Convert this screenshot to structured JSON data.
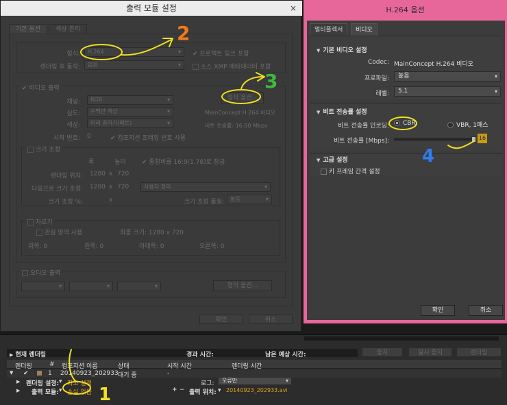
{
  "left_dialog": {
    "title": "출력 모듈 설정",
    "close_glyph": "×",
    "tabs": [
      "기본 옵션",
      "색상 관리"
    ],
    "format_label": "형식:",
    "format_value": "H.264",
    "post_render_label": "렌더링 후 동작:",
    "post_render_value": "없음",
    "include_project_link": "프로젝트 링크 포함",
    "include_xmp": "소스 XMP 메타데이터 포함",
    "video_output": "비디오 출력",
    "channels_label": "채널:",
    "channels_value": "RGB",
    "depth_label": "심도:",
    "depth_value": "수백만 색상",
    "color_label": "색상:",
    "color_value": "미리 곱하기(매트)",
    "start_label": "시작 번호:",
    "start_value": "0",
    "use_comp_frame": "컴포지션 프레임 번호 사용",
    "format_options_button": "형식 옵션...",
    "codec_info_1": "MainConcept H.264 비디오",
    "codec_info_2": "비트 전송률: 16.00 Mbps",
    "resize_label": "크기 조정",
    "width_label": "폭",
    "height_label": "높이",
    "lock_aspect": "종횡비를 16:9(1.78)로 잠금",
    "render_at_label": "렌더링 위치:",
    "render_at_w": "1280",
    "render_at_h": "720",
    "resize_to_label": "다음으로 크기 조정:",
    "resize_to_w": "1280",
    "resize_to_h": "720",
    "resize_to_preset": "사용자 정의",
    "resize_pct_label": "크기 조정 %:",
    "resize_pct_x": "x",
    "resize_quality_label": "크기 조정 품질:",
    "resize_quality_value": "높음",
    "crop_label": "자르기",
    "use_roi": "관심 영역 사용",
    "final_size": "최종 크기: 1280 x 720",
    "crop_top": "위쪽: 0",
    "crop_left": "왼쪽: 0",
    "crop_bottom": "아래쪽: 0",
    "crop_right": "오른쪽: 0",
    "audio_output": "오디오 출력",
    "audio_format_options": "형식 옵션...",
    "ok_button": "확인",
    "cancel_button": "취소"
  },
  "annotations": {
    "num_2": "2",
    "num_3": "3",
    "num_4": "4",
    "num_1": "1",
    "colors": {
      "orange": "#f07a1a",
      "green": "#3fb83f",
      "blue": "#2f7df0",
      "yellow": "#f0e020"
    }
  },
  "right_dialog": {
    "title": "H.264 옵션",
    "tabs": [
      "멀티플렉서",
      "비디오"
    ],
    "basic_section": "기본 비디오 설정",
    "codec_label": "Codec:",
    "codec_value": "MainConcept H.264 비디오",
    "profile_label": "프로파일:",
    "profile_value": "높음",
    "level_label": "레벨:",
    "level_value": "5.1",
    "bitrate_section": "비트 전송률 설정",
    "encoding_label": "비트 전송률 인코딩:",
    "cbr_label": "CBR",
    "vbr_label": "VBR, 1패스",
    "bitrate_label": "비트 전송률 [Mbps]:",
    "bitrate_value": "16",
    "bitrate_fraction": 1.0,
    "advanced_section": "고급 설정",
    "keyframe_label": "키 프레임 간격 설정",
    "ok_button": "확인",
    "cancel_button": "취소",
    "accent": "#e8679a"
  },
  "queue": {
    "current_render": "현재 렌더링",
    "elapsed_label": "경과 시간:",
    "remaining_label": "남은 예상 시간:",
    "stop_button": "중지",
    "pause_button": "일시 중지",
    "render_button": "렌더링",
    "headers": [
      "렌더링",
      "#",
      "컴포지션 이름",
      "상태",
      "시작 시간",
      "렌더링 시간"
    ],
    "row_num": "1",
    "row_comp": "20140923_202933",
    "row_status": "대기 중",
    "row_start": "-",
    "render_settings_label": "렌더링 설정:",
    "render_settings_value": "최고 설정",
    "log_label": "로그:",
    "log_value": "오류만",
    "output_module_label": "출력 모듈:",
    "output_module_value": "손실 없음",
    "output_to_label": "출력 위치:",
    "output_to_value": "20140923_202933.avi",
    "plus_glyph": "+",
    "minus_glyph": "−"
  }
}
